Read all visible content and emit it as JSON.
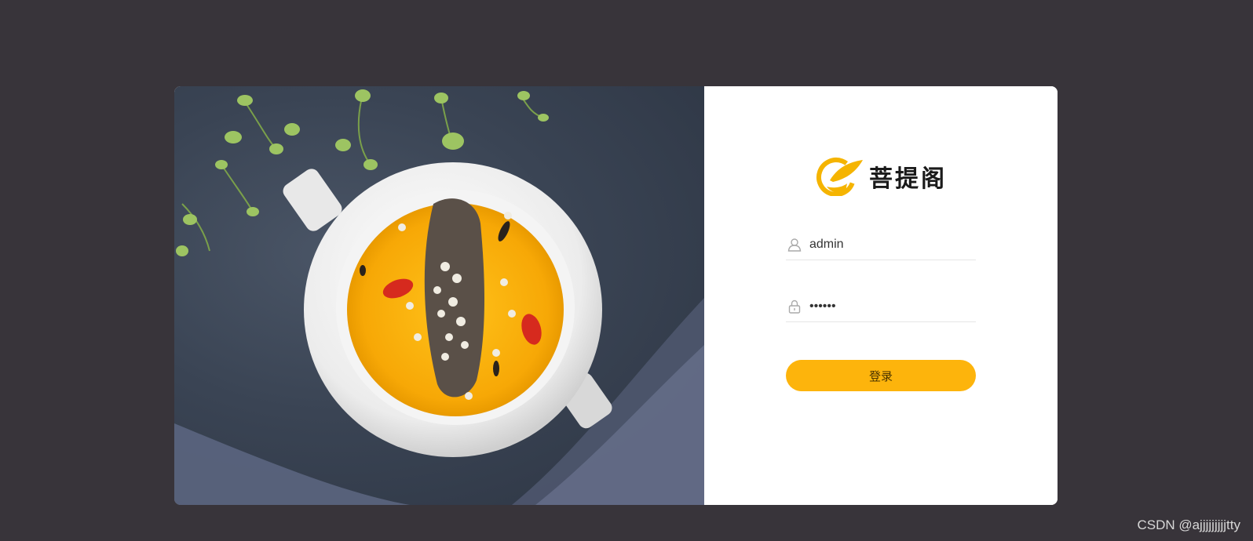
{
  "brand": {
    "name": "菩提阁",
    "accent": "#fdb40c"
  },
  "login": {
    "username": {
      "value": "admin",
      "icon": "user-icon"
    },
    "password": {
      "value": "••••••",
      "icon": "lock-icon"
    },
    "submit_label": "登录"
  },
  "hero": {
    "image": "food-bowl-photo"
  },
  "watermark": "CSDN @ajjjjjjjjjtty"
}
